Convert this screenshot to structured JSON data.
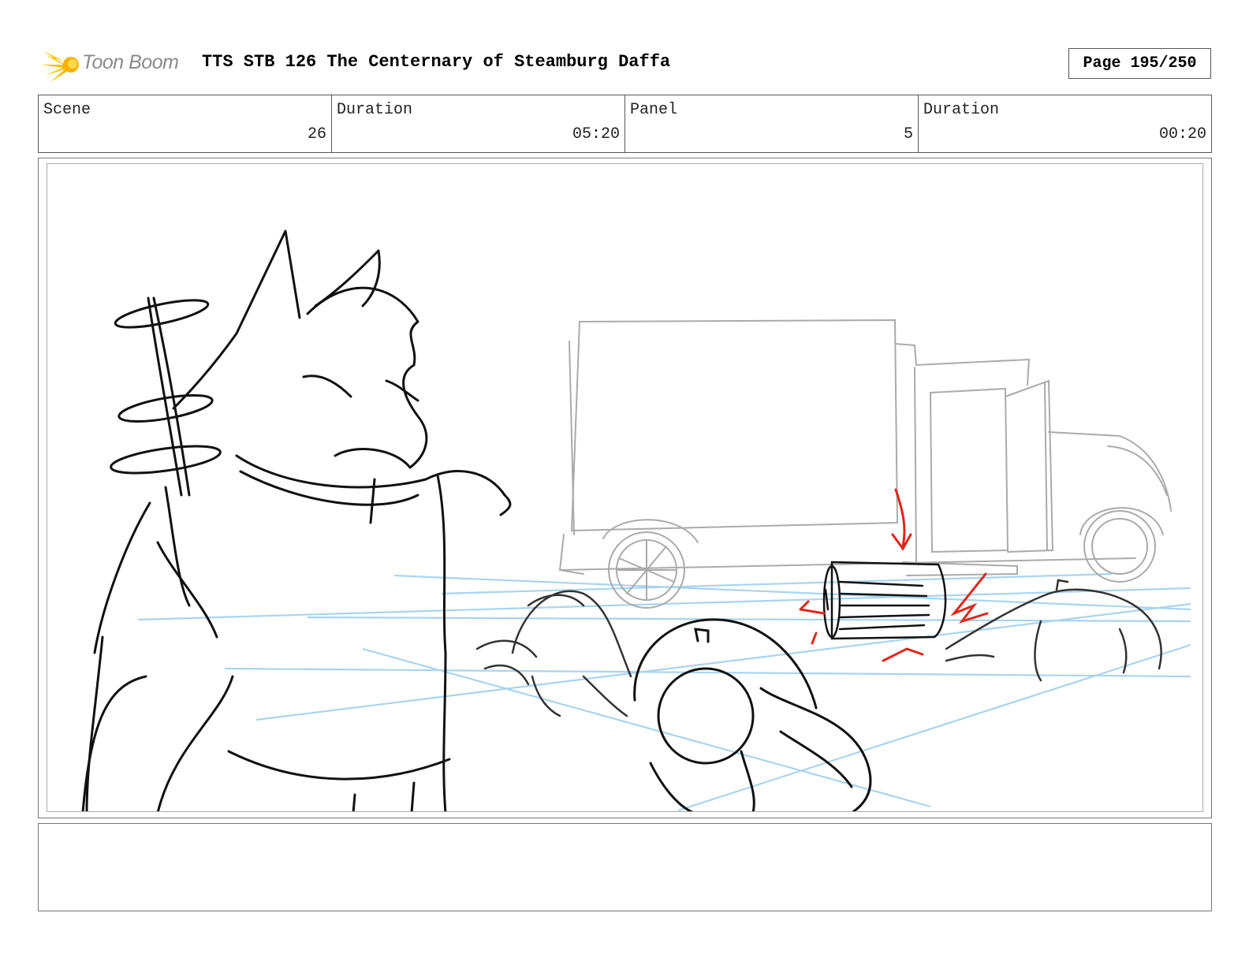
{
  "header": {
    "logo_text": "Toon Boom",
    "title": "TTS STB 126 The Centernary of Steamburg Daffa",
    "page_label": "Page 195/250"
  },
  "info": [
    {
      "label": "Scene",
      "value": "26"
    },
    {
      "label": "Duration",
      "value": "05:20"
    },
    {
      "label": "Panel",
      "value": "5"
    },
    {
      "label": "Duration",
      "value": "00:20"
    }
  ],
  "panel": {
    "description": "",
    "colors": {
      "ink": "#111111",
      "truck": "#aaaaaa",
      "guides": "#a9d4ee",
      "notes": "#e0261b"
    }
  },
  "notes": {
    "text": ""
  }
}
